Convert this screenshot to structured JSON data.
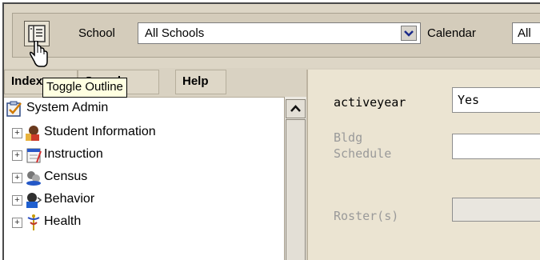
{
  "toolbar": {
    "school_label": "School",
    "school_value": "All Schools",
    "calendar_label": "Calendar",
    "calendar_value": "All",
    "outline_icon": "outline-icon"
  },
  "tooltip": {
    "text": "Toggle Outline"
  },
  "tabs": [
    {
      "label": "Index"
    },
    {
      "label": "Search"
    },
    {
      "label": "Help"
    }
  ],
  "tree": {
    "root": {
      "label": "System Admin",
      "icon": "clipboard-check-icon"
    },
    "items": [
      {
        "label": "Student Information",
        "icon": "student-icon"
      },
      {
        "label": "Instruction",
        "icon": "instruction-icon"
      },
      {
        "label": "Census",
        "icon": "census-icon"
      },
      {
        "label": "Behavior",
        "icon": "behavior-icon"
      },
      {
        "label": "Health",
        "icon": "health-icon"
      }
    ]
  },
  "form": {
    "activeyear_label": "activeyear",
    "activeyear_value": "Yes",
    "bldg_label_line1": "Bldg",
    "bldg_label_line2": "Schedule",
    "roster_label": "Roster(s)"
  },
  "colors": {
    "frame_bg": "#d9d2c2",
    "form_bg": "#ebe4d2",
    "tooltip_bg": "#ffffe1"
  }
}
